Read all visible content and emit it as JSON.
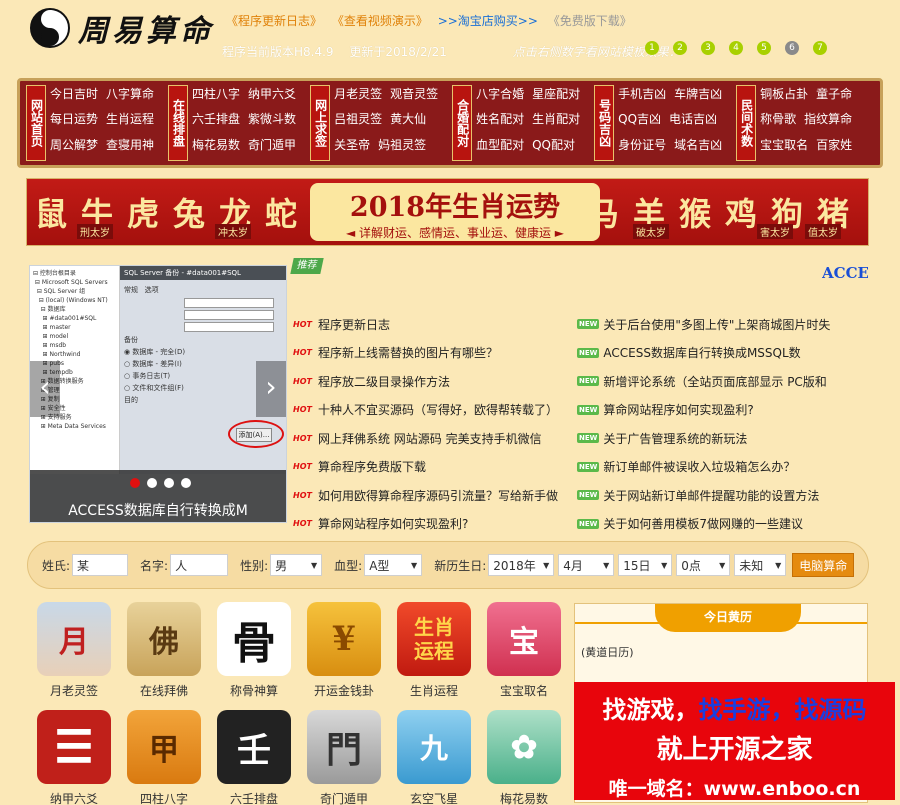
{
  "header": {
    "logo_text": "周易算命",
    "links": [
      {
        "text": "《程序更新日志》",
        "color": "#e0820a"
      },
      {
        "text": "《查看视频演示》",
        "color": "#e0820a"
      },
      {
        "text": ">>淘宝店购买>>",
        "color": "#1a6fd6"
      },
      {
        "text": "《免费版下载》",
        "color": "#999999"
      }
    ],
    "version_text": "程序当前版本H8.4.9",
    "updated_text": "更新于2018/2/21",
    "template_hint": "点击右侧数字看网站模板效果：",
    "color_dots": [
      {
        "label": "1",
        "color": "#a8d000"
      },
      {
        "label": "2",
        "color": "#a8d000"
      },
      {
        "label": "3",
        "color": "#a8d000"
      },
      {
        "label": "4",
        "color": "#a8d000"
      },
      {
        "label": "5",
        "color": "#a8d000"
      },
      {
        "label": "6",
        "color": "#8a8a8a"
      },
      {
        "label": "7",
        "color": "#a8d000"
      }
    ]
  },
  "nav": {
    "groups": [
      {
        "title": "网站首页",
        "rows": [
          [
            "今日吉时",
            "八字算命"
          ],
          [
            "每日运势",
            "生肖运程"
          ],
          [
            "周公解梦",
            "查寝用神"
          ]
        ]
      },
      {
        "title": "在线排盘",
        "rows": [
          [
            "四柱八字",
            "纳甲六爻"
          ],
          [
            "六壬排盘",
            "紫微斗数"
          ],
          [
            "梅花易数",
            "奇门遁甲"
          ]
        ]
      },
      {
        "title": "网上求签",
        "rows": [
          [
            "月老灵签",
            "观音灵签"
          ],
          [
            "吕祖灵签",
            "黄大仙"
          ],
          [
            "关圣帝",
            "妈祖灵签"
          ]
        ]
      },
      {
        "title": "合婚配对",
        "rows": [
          [
            "八字合婚",
            "星座配对"
          ],
          [
            "姓名配对",
            "生肖配对"
          ],
          [
            "血型配对",
            "QQ配对"
          ]
        ]
      },
      {
        "title": "号码吉凶",
        "rows": [
          [
            "手机吉凶",
            "车牌吉凶"
          ],
          [
            "QQ吉凶",
            "电话吉凶"
          ],
          [
            "身份证号",
            "域名吉凶"
          ]
        ]
      },
      {
        "title": "民间术数",
        "rows": [
          [
            "铜板占卦",
            "童子命"
          ],
          [
            "称骨歌",
            "指纹算命"
          ],
          [
            "宝宝取名",
            "百家姓"
          ]
        ]
      }
    ]
  },
  "zodiac": {
    "left_animals": [
      "鼠",
      "牛",
      "虎",
      "兔",
      "龙",
      "蛇"
    ],
    "right_animals": [
      "马",
      "羊",
      "猴",
      "鸡",
      "狗",
      "猪"
    ],
    "left_tags": [
      "刑太岁",
      "冲太岁"
    ],
    "right_tags": [
      "破太岁",
      "害太岁",
      "值太岁"
    ],
    "title": "2018年生肖运势",
    "subtitle": "◄ 详解财运、感情运、事业运、健康运 ►"
  },
  "slider": {
    "caption": "ACCESS数据库自行转换成M",
    "active_index": 0,
    "dot_count": 4
  },
  "news": {
    "ribbon": "推荐",
    "marquee": "ACCESS",
    "hot_tag": "HOT",
    "new_tag": "NEW",
    "left": [
      "程序更新日志",
      "程序新上线需替换的图片有哪些？",
      "程序放二级目录操作方法",
      "十种人不宜买源码（写得好，欧得帮转载了）",
      "网上拜佛系统 网站源码 完美支持手机微信",
      "算命程序免费版下载",
      "如何用欧得算命程序源码引流量？写给新手做",
      "算命网站程序如何实现盈利?"
    ],
    "right": [
      "关于后台使用\"多图上传\"上架商城图片时失",
      "ACCESS数据库自行转换成MSSQL数",
      "新增评论系统（全站页面底部显示 PC版和",
      "算命网站程序如何实现盈利?",
      "关于广告管理系统的新玩法",
      "新订单邮件被误收入垃圾箱怎么办？",
      "关于网站新订单邮件提醒功能的设置方法",
      "关于如何善用模板7做网赚的一些建议"
    ]
  },
  "form": {
    "surname_label": "姓氏:",
    "surname_value": "某",
    "name_label": "名字:",
    "name_value": "人",
    "gender_label": "性别:",
    "gender_value": "男",
    "blood_label": "血型:",
    "blood_value": "A型",
    "birthday_label": "新历生日:",
    "year_value": "2018年",
    "month_value": "4月",
    "day_value": "15日",
    "hour_value": "0点",
    "minute_value": "未知",
    "submit_label": "电脑算命"
  },
  "icons": [
    {
      "label": "月老灵签",
      "glyph": "月"
    },
    {
      "label": "在线拜佛",
      "glyph": "佛"
    },
    {
      "label": "称骨神算",
      "glyph": "骨"
    },
    {
      "label": "开运金钱卦",
      "glyph": "¥"
    },
    {
      "label": "生肖运程",
      "glyph": "生肖运程"
    },
    {
      "label": "宝宝取名",
      "glyph": "宝"
    },
    {
      "label": "纳甲六爻",
      "glyph": "☰"
    },
    {
      "label": "四柱八字",
      "glyph": "甲"
    },
    {
      "label": "六壬排盘",
      "glyph": "壬"
    },
    {
      "label": "奇门遁甲",
      "glyph": "門"
    },
    {
      "label": "玄空飞星",
      "glyph": "九"
    },
    {
      "label": "梅花易数",
      "glyph": "✿"
    }
  ],
  "almanac": {
    "title": "今日黄历",
    "text": "(黄道日历)"
  },
  "ad": {
    "line1_a": "找游戏，",
    "line1_b": "找手游，",
    "line1_c": "找源码",
    "line2": "就上开源之家",
    "line3": "唯一域名：www.enboo.cn"
  }
}
